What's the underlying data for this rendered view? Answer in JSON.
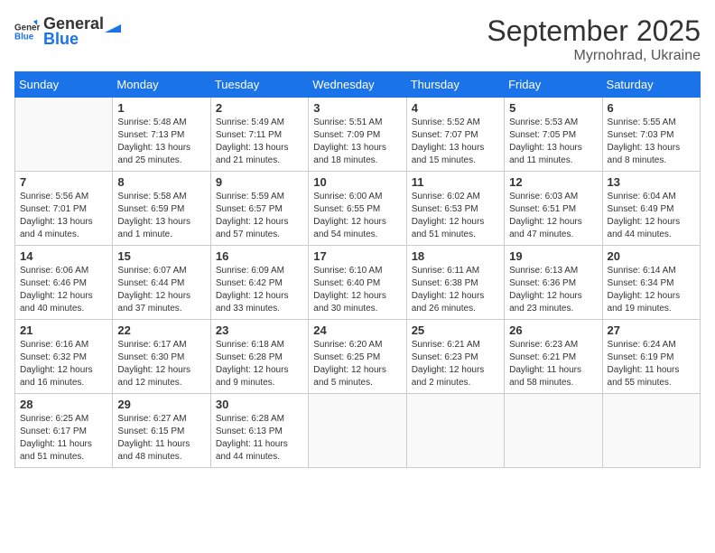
{
  "logo": {
    "text_general": "General",
    "text_blue": "Blue"
  },
  "title": {
    "month": "September 2025",
    "location": "Myrnohrad, Ukraine"
  },
  "weekdays": [
    "Sunday",
    "Monday",
    "Tuesday",
    "Wednesday",
    "Thursday",
    "Friday",
    "Saturday"
  ],
  "weeks": [
    [
      {
        "day": "",
        "info": ""
      },
      {
        "day": "1",
        "info": "Sunrise: 5:48 AM\nSunset: 7:13 PM\nDaylight: 13 hours\nand 25 minutes."
      },
      {
        "day": "2",
        "info": "Sunrise: 5:49 AM\nSunset: 7:11 PM\nDaylight: 13 hours\nand 21 minutes."
      },
      {
        "day": "3",
        "info": "Sunrise: 5:51 AM\nSunset: 7:09 PM\nDaylight: 13 hours\nand 18 minutes."
      },
      {
        "day": "4",
        "info": "Sunrise: 5:52 AM\nSunset: 7:07 PM\nDaylight: 13 hours\nand 15 minutes."
      },
      {
        "day": "5",
        "info": "Sunrise: 5:53 AM\nSunset: 7:05 PM\nDaylight: 13 hours\nand 11 minutes."
      },
      {
        "day": "6",
        "info": "Sunrise: 5:55 AM\nSunset: 7:03 PM\nDaylight: 13 hours\nand 8 minutes."
      }
    ],
    [
      {
        "day": "7",
        "info": "Sunrise: 5:56 AM\nSunset: 7:01 PM\nDaylight: 13 hours\nand 4 minutes."
      },
      {
        "day": "8",
        "info": "Sunrise: 5:58 AM\nSunset: 6:59 PM\nDaylight: 13 hours\nand 1 minute."
      },
      {
        "day": "9",
        "info": "Sunrise: 5:59 AM\nSunset: 6:57 PM\nDaylight: 12 hours\nand 57 minutes."
      },
      {
        "day": "10",
        "info": "Sunrise: 6:00 AM\nSunset: 6:55 PM\nDaylight: 12 hours\nand 54 minutes."
      },
      {
        "day": "11",
        "info": "Sunrise: 6:02 AM\nSunset: 6:53 PM\nDaylight: 12 hours\nand 51 minutes."
      },
      {
        "day": "12",
        "info": "Sunrise: 6:03 AM\nSunset: 6:51 PM\nDaylight: 12 hours\nand 47 minutes."
      },
      {
        "day": "13",
        "info": "Sunrise: 6:04 AM\nSunset: 6:49 PM\nDaylight: 12 hours\nand 44 minutes."
      }
    ],
    [
      {
        "day": "14",
        "info": "Sunrise: 6:06 AM\nSunset: 6:46 PM\nDaylight: 12 hours\nand 40 minutes."
      },
      {
        "day": "15",
        "info": "Sunrise: 6:07 AM\nSunset: 6:44 PM\nDaylight: 12 hours\nand 37 minutes."
      },
      {
        "day": "16",
        "info": "Sunrise: 6:09 AM\nSunset: 6:42 PM\nDaylight: 12 hours\nand 33 minutes."
      },
      {
        "day": "17",
        "info": "Sunrise: 6:10 AM\nSunset: 6:40 PM\nDaylight: 12 hours\nand 30 minutes."
      },
      {
        "day": "18",
        "info": "Sunrise: 6:11 AM\nSunset: 6:38 PM\nDaylight: 12 hours\nand 26 minutes."
      },
      {
        "day": "19",
        "info": "Sunrise: 6:13 AM\nSunset: 6:36 PM\nDaylight: 12 hours\nand 23 minutes."
      },
      {
        "day": "20",
        "info": "Sunrise: 6:14 AM\nSunset: 6:34 PM\nDaylight: 12 hours\nand 19 minutes."
      }
    ],
    [
      {
        "day": "21",
        "info": "Sunrise: 6:16 AM\nSunset: 6:32 PM\nDaylight: 12 hours\nand 16 minutes."
      },
      {
        "day": "22",
        "info": "Sunrise: 6:17 AM\nSunset: 6:30 PM\nDaylight: 12 hours\nand 12 minutes."
      },
      {
        "day": "23",
        "info": "Sunrise: 6:18 AM\nSunset: 6:28 PM\nDaylight: 12 hours\nand 9 minutes."
      },
      {
        "day": "24",
        "info": "Sunrise: 6:20 AM\nSunset: 6:25 PM\nDaylight: 12 hours\nand 5 minutes."
      },
      {
        "day": "25",
        "info": "Sunrise: 6:21 AM\nSunset: 6:23 PM\nDaylight: 12 hours\nand 2 minutes."
      },
      {
        "day": "26",
        "info": "Sunrise: 6:23 AM\nSunset: 6:21 PM\nDaylight: 11 hours\nand 58 minutes."
      },
      {
        "day": "27",
        "info": "Sunrise: 6:24 AM\nSunset: 6:19 PM\nDaylight: 11 hours\nand 55 minutes."
      }
    ],
    [
      {
        "day": "28",
        "info": "Sunrise: 6:25 AM\nSunset: 6:17 PM\nDaylight: 11 hours\nand 51 minutes."
      },
      {
        "day": "29",
        "info": "Sunrise: 6:27 AM\nSunset: 6:15 PM\nDaylight: 11 hours\nand 48 minutes."
      },
      {
        "day": "30",
        "info": "Sunrise: 6:28 AM\nSunset: 6:13 PM\nDaylight: 11 hours\nand 44 minutes."
      },
      {
        "day": "",
        "info": ""
      },
      {
        "day": "",
        "info": ""
      },
      {
        "day": "",
        "info": ""
      },
      {
        "day": "",
        "info": ""
      }
    ]
  ]
}
